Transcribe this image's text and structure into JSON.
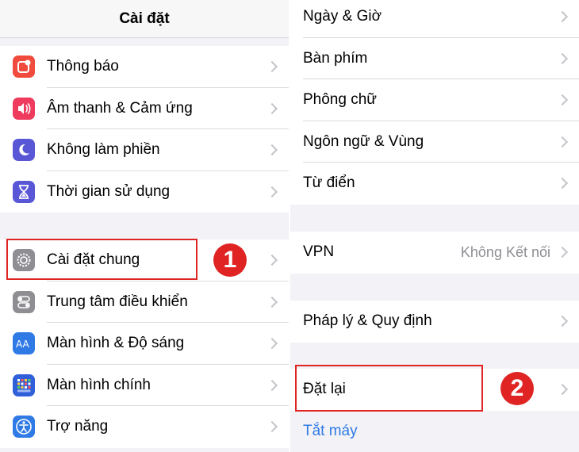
{
  "left": {
    "title": "Cài đặt",
    "group1": [
      {
        "label": "Thông báo",
        "icon": "notifications-icon",
        "color": "#f04b3c"
      },
      {
        "label": "Âm thanh & Cảm ứng",
        "icon": "speaker-icon",
        "color": "#ef3b5d"
      },
      {
        "label": "Không làm phiền",
        "icon": "moon-icon",
        "color": "#5a57d6"
      },
      {
        "label": "Thời gian sử dụng",
        "icon": "hourglass-icon",
        "color": "#5a57d6"
      }
    ],
    "group2": [
      {
        "label": "Cài đặt chung",
        "icon": "gear-icon",
        "color": "#8e8e93"
      },
      {
        "label": "Trung tâm điều khiển",
        "icon": "toggles-icon",
        "color": "#8e8e93"
      },
      {
        "label": "Màn hình & Độ sáng",
        "icon": "display-aa-icon",
        "color": "#2f7ae5"
      },
      {
        "label": "Màn hình chính",
        "icon": "home-grid-icon",
        "color": "#2f5fd9"
      },
      {
        "label": "Trợ năng",
        "icon": "accessibility-icon",
        "color": "#2f7ae5"
      }
    ]
  },
  "right": {
    "group1": [
      {
        "label": "Ngày & Giờ"
      },
      {
        "label": "Bàn phím"
      },
      {
        "label": "Phông chữ"
      },
      {
        "label": "Ngôn ngữ & Vùng"
      },
      {
        "label": "Từ điển"
      }
    ],
    "vpn": {
      "label": "VPN",
      "value": "Không Kết nối"
    },
    "legal": {
      "label": "Pháp lý & Quy định"
    },
    "reset": {
      "label": "Đặt lại"
    },
    "shutdown": {
      "label": "Tắt máy"
    }
  },
  "annotations": [
    {
      "number": "1",
      "color": "#e02424"
    },
    {
      "number": "2",
      "color": "#e02424"
    }
  ]
}
